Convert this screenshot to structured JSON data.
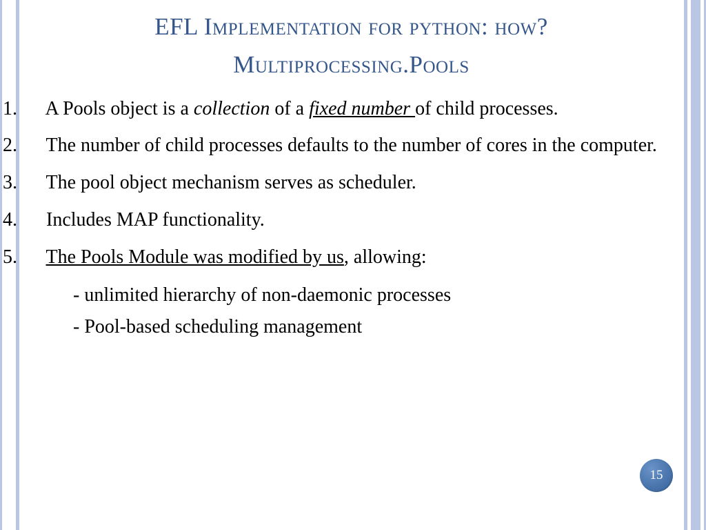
{
  "title": {
    "line1": "EFL Implementation for python: how?",
    "line2": "Multiprocessing.Pools"
  },
  "points": {
    "p1": {
      "num": "1.",
      "a": "A Pools object is a ",
      "b": "collection",
      "c": " of a ",
      "d": "fixed number ",
      "e": "of child processes."
    },
    "p2": {
      "num": "2.",
      "text": "The number of child processes defaults to the number of cores in the computer."
    },
    "p3": {
      "num": "3.",
      "text": "The pool object mechanism serves as scheduler."
    },
    "p4": {
      "num": "4.",
      "text": "Includes MAP functionality."
    },
    "p5": {
      "num": "5.",
      "a": "The Pools Module was modified by us",
      "b": ", allowing:"
    }
  },
  "sub": {
    "s1": "- unlimited hierarchy of non-daemonic processes",
    "s2": "- Pool-based scheduling management"
  },
  "page": "15"
}
